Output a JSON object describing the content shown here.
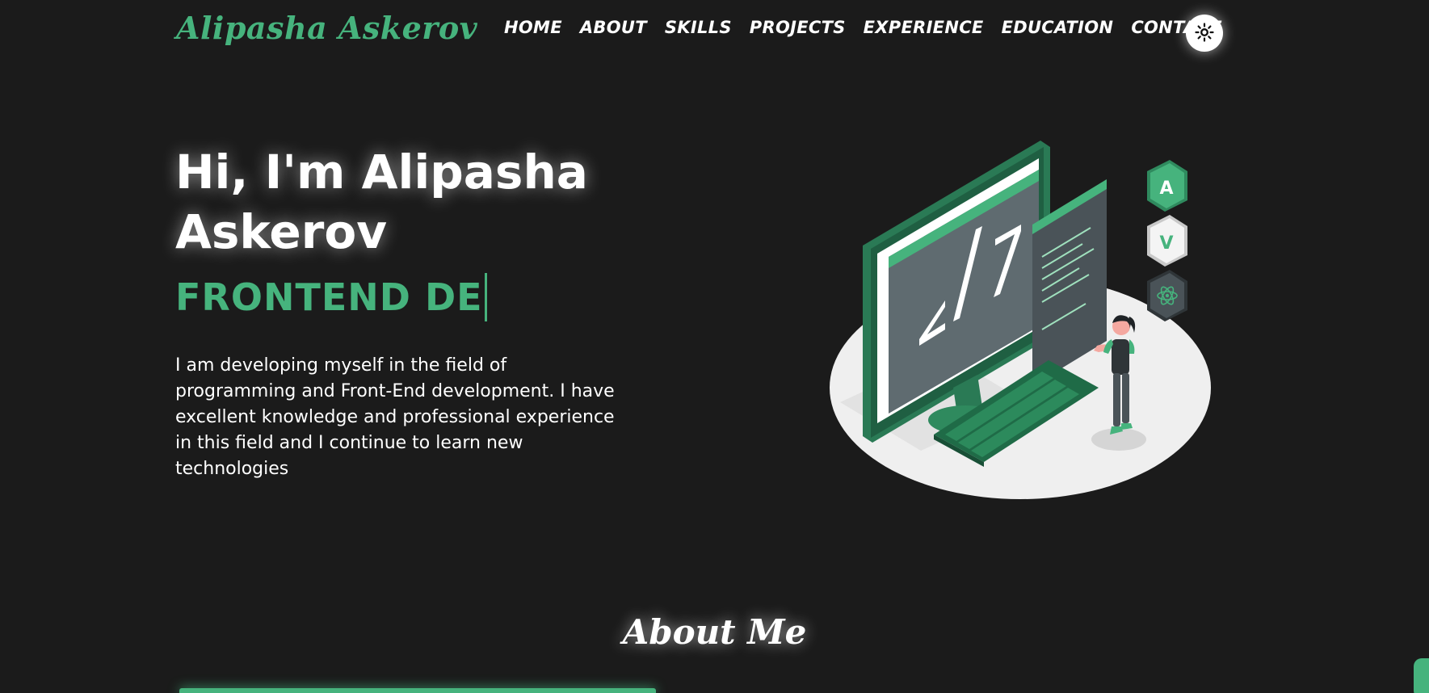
{
  "header": {
    "brand": "Alipasha Askerov",
    "nav": [
      "HOME",
      "ABOUT",
      "SKILLS",
      "PROJECTS",
      "EXPERIENCE",
      "EDUCATION",
      "CONTACT"
    ],
    "theme_toggle_icon": "sun-icon"
  },
  "hero": {
    "title_line1": "Hi, I'm Alipasha",
    "title_line2": "Askerov",
    "typed_text": "FRONTEND DE",
    "description": "I am developing myself in the field of programming and Front-End development. I have excellent knowledge and professional experience in this field and I continue to learn new technologies",
    "illustration": "developer-illustration",
    "illustration_badges": [
      "A",
      "V"
    ]
  },
  "about": {
    "title": "About Me"
  },
  "colors": {
    "accent": "#46b37d",
    "background": "#1b1b1b",
    "text": "#ffffff"
  }
}
